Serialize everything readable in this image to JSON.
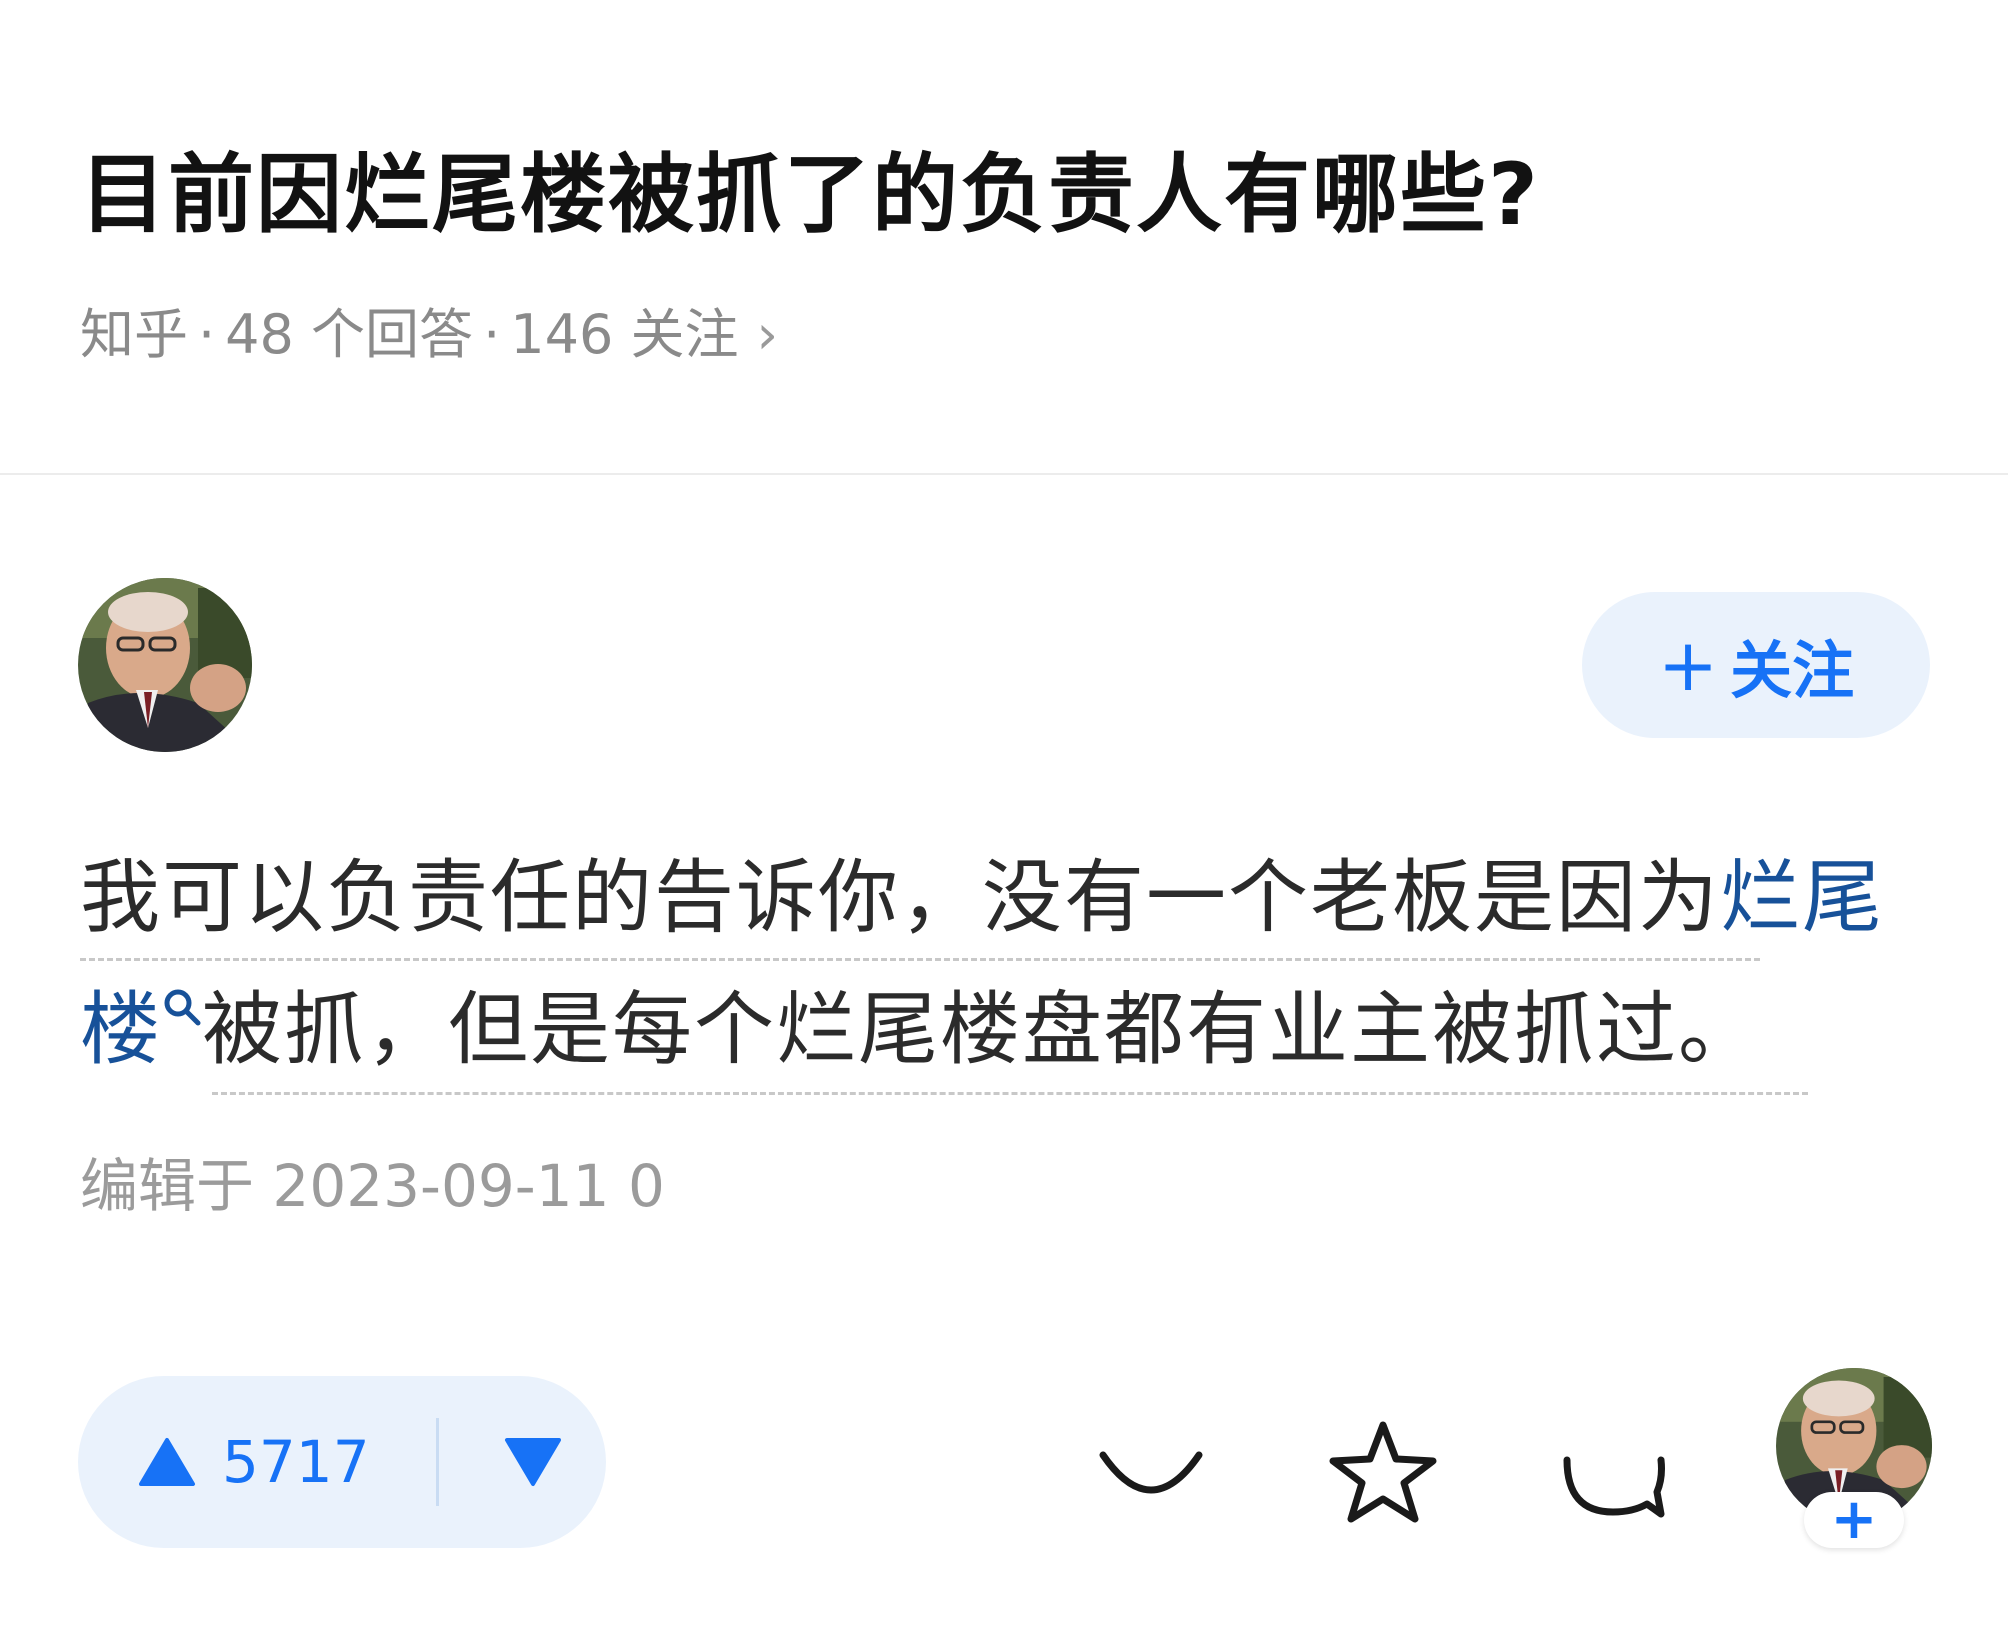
{
  "question": {
    "title": "目前因烂尾楼被抓了的负责人有哪些?",
    "source": "知乎",
    "answers": "48 个回答",
    "followers": "146 关注",
    "separator": "·"
  },
  "author": {
    "name": "",
    "follow_label": "关注",
    "follow_plus": "+"
  },
  "answer": {
    "line1_text": "我可以负责任的告诉你，没有一个老板是因为",
    "line1_link": "烂尾",
    "line2_link": "楼",
    "line2_text": "被抓，但是每个烂尾楼盘都有业主被抓过。",
    "edited": "编辑于 2023-09-11 0"
  },
  "actions": {
    "upvotes": "5717",
    "icons": [
      "upvote-icon",
      "downvote-icon",
      "collapse-icon",
      "star-icon",
      "comment-icon",
      "avatar-follow-icon"
    ]
  },
  "colors": {
    "accent": "#1772f6",
    "link": "#175199",
    "pill_bg": "#eaf2fc",
    "meta": "#8a8a8a"
  }
}
